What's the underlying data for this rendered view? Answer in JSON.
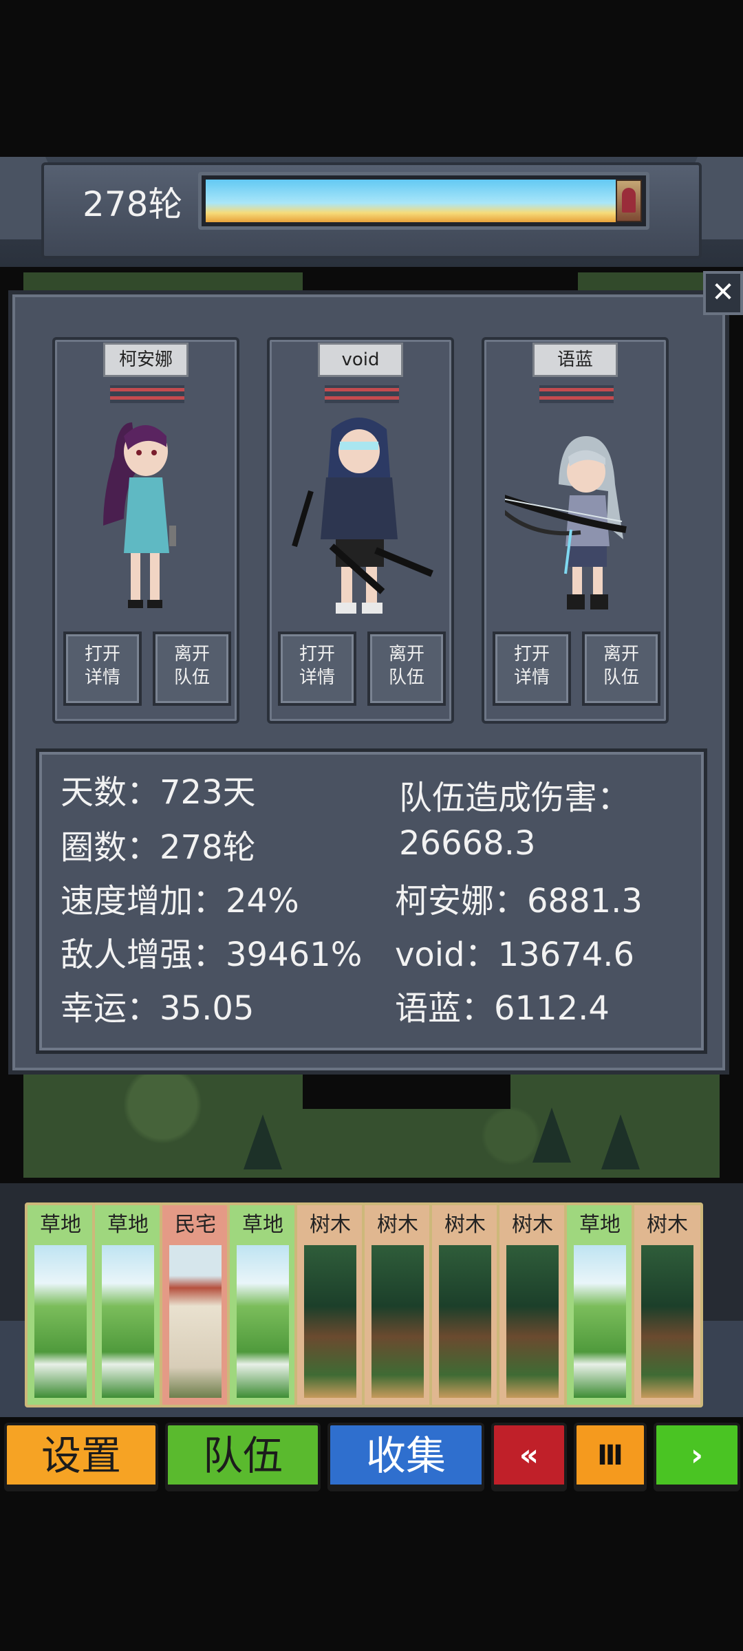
{
  "header": {
    "round_label": "278轮",
    "route_progress": 1.0
  },
  "party": {
    "members": [
      {
        "name": "柯安娜",
        "open_details_label": "打开\n详情",
        "leave_team_label": "离开\n队伍"
      },
      {
        "name": "void",
        "open_details_label": "打开\n详情",
        "leave_team_label": "离开\n队伍"
      },
      {
        "name": "语蓝",
        "open_details_label": "打开\n详情",
        "leave_team_label": "离开\n队伍"
      }
    ],
    "close_label": "✕"
  },
  "stats": {
    "days": "天数：723天",
    "laps": "圈数：278轮",
    "speed_bonus": "速度增加：24%",
    "enemy_boost": "敌人增强：39461%",
    "luck": "幸运：35.05",
    "team_damage_title": "队伍造成伤害：",
    "team_damage_value": "26668.3",
    "member_damage": [
      "柯安娜：6881.3",
      "void：13674.6",
      "语蓝：6112.4"
    ]
  },
  "hand": [
    {
      "label": "草地",
      "kind": "grass"
    },
    {
      "label": "草地",
      "kind": "grass"
    },
    {
      "label": "民宅",
      "kind": "house"
    },
    {
      "label": "草地",
      "kind": "grass"
    },
    {
      "label": "树木",
      "kind": "tree"
    },
    {
      "label": "树木",
      "kind": "tree"
    },
    {
      "label": "树木",
      "kind": "tree"
    },
    {
      "label": "树木",
      "kind": "tree"
    },
    {
      "label": "草地",
      "kind": "grass"
    },
    {
      "label": "树木",
      "kind": "tree"
    }
  ],
  "bottom_bar": {
    "settings_label": "设置",
    "team_label": "队伍",
    "collect_label": "收集",
    "rewind_icon": "«",
    "pause_icon": "Ⅲ",
    "play_icon": "›"
  },
  "colors": {
    "settings": "#f6a324",
    "team": "#5aba2e",
    "collect": "#2f6fce",
    "rewind": "#c02029",
    "pause": "#f59a1e",
    "play": "#4ac423"
  }
}
